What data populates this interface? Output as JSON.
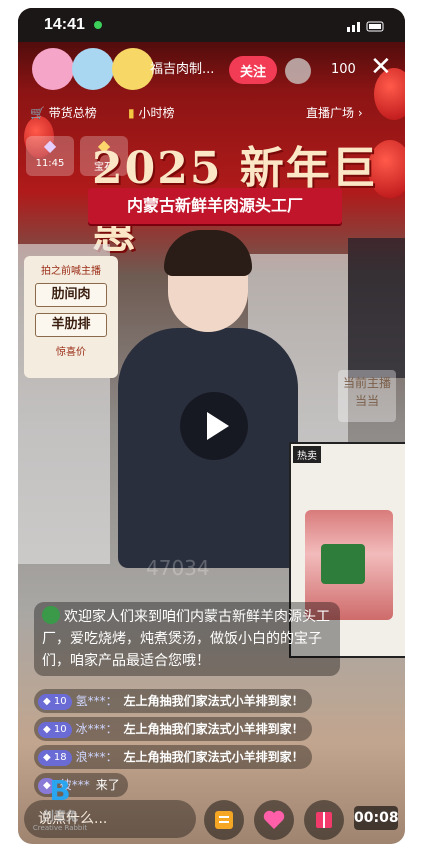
{
  "status_bar": {
    "time": "14:41",
    "dot_color": "#3ccf5a"
  },
  "header": {
    "shop_name": "福吉肉制...",
    "follow_label": "关注",
    "viewer_count": "100",
    "close_icon": "close-icon"
  },
  "subbar": {
    "rank_label": "带货总榜",
    "hour_rank_label": "小时榜",
    "live_square_label": "直播广场",
    "time_tag": "11:45",
    "treasure_label": "宝石"
  },
  "banner": {
    "title": "2025 新年巨惠",
    "ribbon": "内蒙古新鲜羊肉源头工厂"
  },
  "side_panel": {
    "header": "拍之前喊主播",
    "items": [
      "肋间肉",
      "羊肋排"
    ],
    "footer": "惊喜价"
  },
  "host_card": {
    "line1": "当前主播",
    "line2": "当当"
  },
  "pip": {
    "label": "热卖"
  },
  "comments": {
    "main": "欢迎家人们来到咱们内蒙古新鲜羊肉源头工厂，爱吃烧烤，炖煮煲汤，做饭小白的的宝子们，咱家产品最适合您哦！",
    "chat": [
      {
        "level": "10",
        "user": "氢***：",
        "message": "左上角抽我们家法式小羊排到家！"
      },
      {
        "level": "10",
        "user": "冰***：",
        "message": "左上角抽我们家法式小羊排到家！"
      },
      {
        "level": "18",
        "user": "浪***：",
        "message": "左上角抽我们家法式小羊排到家！"
      }
    ],
    "join": {
      "user": "彼***",
      "action": "来了"
    }
  },
  "bottom": {
    "input_placeholder": "说点什么...",
    "timer": "00:08"
  },
  "logo": {
    "name": "创意兔",
    "sub": "Creative Rabbit"
  },
  "watermark": "47034",
  "colors": {
    "follow": "#f23b55",
    "ribbon": "#c0152a",
    "banner_text": "#fbe7c6"
  }
}
